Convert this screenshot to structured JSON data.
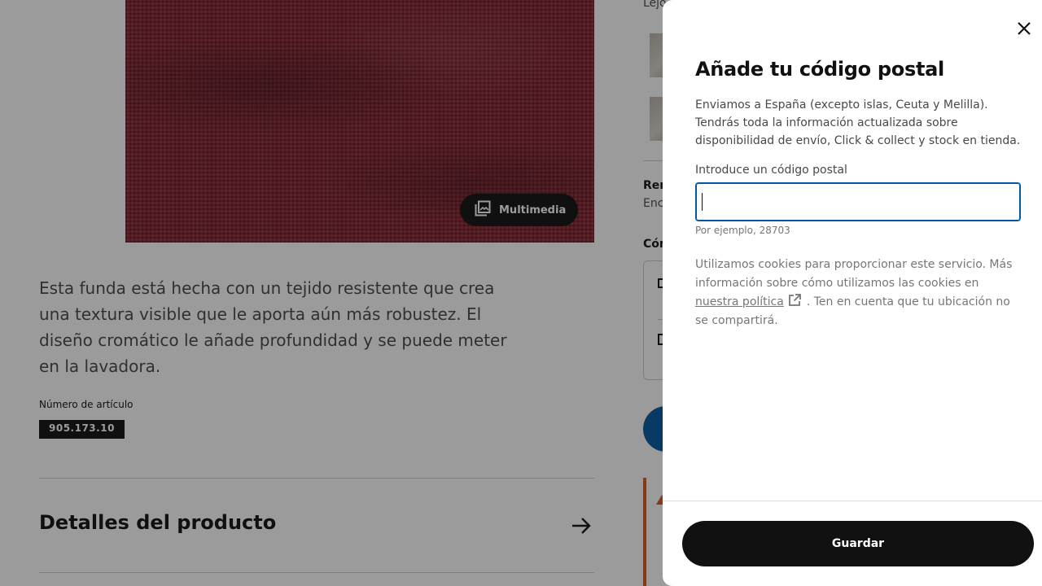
{
  "product": {
    "multimedia_label": "Multimedia",
    "description": "Esta funda está hecha con un tejido resistente que crea una textura visible que le aporta aún más robustez. El diseño cromático le añade profundidad y se puede meter en la lavadora.",
    "article_label": "Número de artículo",
    "article_number": "905.173.10",
    "details_title": "Detalles del producto"
  },
  "right_column": {
    "top_text": "Lejo",
    "section1_label": "Ren",
    "section1_value": "Enc",
    "section2_label": "Cón"
  },
  "postal_modal": {
    "title": "Añade tu código postal",
    "description": "Enviamos a España (excepto islas, Ceuta y Melilla). Tendrás toda la información actualizada sobre disponibilidad de envío, Click & collect y stock en tienda.",
    "field_label": "Introduce un código postal",
    "field_value": "",
    "field_hint": "Por ejemplo, 28703",
    "cookie_text_before": "Utilizamos cookies para proporcionar este servicio. Más información sobre cómo utilizamos las cookies en",
    "cookie_link": "nuestra política",
    "cookie_text_after": ". Ten en cuenta que tu ubicación no se compartirá.",
    "save_label": "Guardar"
  },
  "icons": {
    "close": "close-icon",
    "multimedia": "image-gallery-icon",
    "arrow": "arrow-right-icon",
    "external_link": "external-link-icon"
  },
  "colors": {
    "input_focus": "#0058a3",
    "primary_button": "#111111",
    "warning": "#e0561b",
    "fabric": "#8a1f2c"
  }
}
